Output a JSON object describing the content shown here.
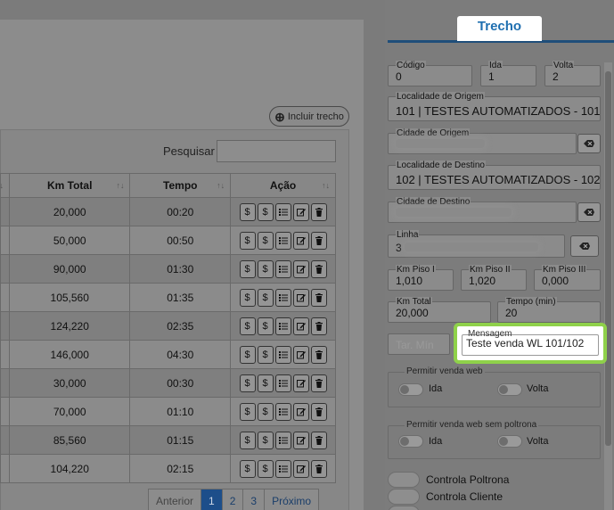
{
  "table": {
    "include_button": "Incluir trecho",
    "search_label": "Pesquisar",
    "search_value": "",
    "headers": {
      "km_total": "Km Total",
      "tempo": "Tempo",
      "acao": "Ação"
    },
    "sort_glyph": "↑↓",
    "rows": [
      {
        "km_total": "20,000",
        "tempo": "00:20"
      },
      {
        "km_total": "50,000",
        "tempo": "00:50"
      },
      {
        "km_total": "90,000",
        "tempo": "01:30"
      },
      {
        "km_total": "105,560",
        "tempo": "01:35"
      },
      {
        "km_total": "124,220",
        "tempo": "02:35"
      },
      {
        "km_total": "146,000",
        "tempo": "04:30"
      },
      {
        "km_total": "30,000",
        "tempo": "00:30"
      },
      {
        "km_total": "70,000",
        "tempo": "01:10"
      },
      {
        "km_total": "85,560",
        "tempo": "01:15"
      },
      {
        "km_total": "104,220",
        "tempo": "02:15"
      }
    ],
    "action_icons": [
      "dollar-icon",
      "dollar-icon",
      "list-icon",
      "edit-icon",
      "trash-icon"
    ],
    "action_glyph_dollar": "$"
  },
  "pager": {
    "prev": "Anterior",
    "pages": [
      "1",
      "2",
      "3"
    ],
    "next": "Próximo",
    "active_page": "1"
  },
  "form": {
    "tab_title": "Trecho",
    "codigo": {
      "label": "Código",
      "value": "0"
    },
    "ida": {
      "label": "Ida",
      "value": "1"
    },
    "volta": {
      "label": "Volta",
      "value": "2"
    },
    "localidade_origem": {
      "label": "Localidade de Origem",
      "value": "101 | TESTES AUTOMATIZADOS - 101"
    },
    "cidade_origem": {
      "label": "Cidade de Origem",
      "value": ""
    },
    "localidade_destino": {
      "label": "Localidade de Destino",
      "value": "102 | TESTES AUTOMATIZADOS - 102"
    },
    "cidade_destino": {
      "label": "Cidade de Destino",
      "value": ""
    },
    "linha": {
      "label": "Linha",
      "value": "3"
    },
    "km_piso_1": {
      "label": "Km Piso I",
      "value": "1,010"
    },
    "km_piso_2": {
      "label": "Km Piso II",
      "value": "1,020"
    },
    "km_piso_3": {
      "label": "Km Piso III",
      "value": "0,000"
    },
    "km_total": {
      "label": "Km Total",
      "value": "20,000"
    },
    "tempo_min": {
      "label": "Tempo (min)",
      "value": "20"
    },
    "tar_min": {
      "placeholder": "Tar. Mín"
    },
    "mensagem": {
      "label": "Mensagem",
      "value": "Teste venda WL 101/102"
    },
    "venda_web": {
      "label": "Permitir venda web",
      "ida": "Ida",
      "volta": "Volta"
    },
    "venda_web_sem_poltrona": {
      "label": "Permitir venda web sem poltrona",
      "ida": "Ida",
      "volta": "Volta"
    },
    "controla_poltrona": "Controla Poltrona",
    "controla_cliente": "Controla Cliente"
  },
  "colors": {
    "accent": "#1f6fb0",
    "highlight": "#8fd14a",
    "active_page": "#1d4e8a"
  }
}
